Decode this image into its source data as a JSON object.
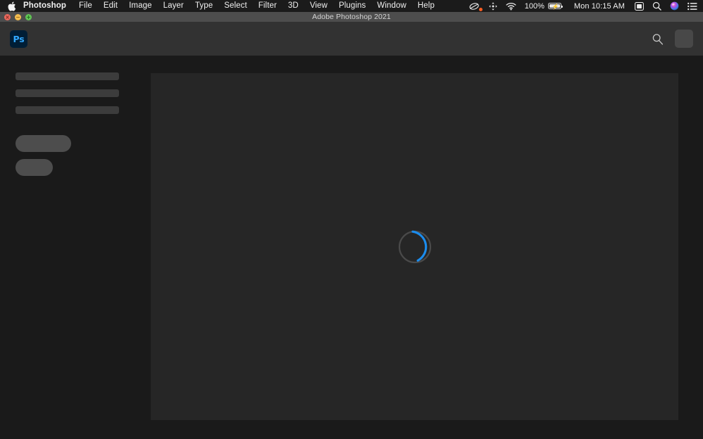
{
  "menubar": {
    "apple_icon": "apple-logo-icon",
    "items": [
      {
        "label": "Photoshop",
        "bold": true
      },
      {
        "label": "File",
        "bold": false
      },
      {
        "label": "Edit",
        "bold": false
      },
      {
        "label": "Image",
        "bold": false
      },
      {
        "label": "Layer",
        "bold": false
      },
      {
        "label": "Type",
        "bold": false
      },
      {
        "label": "Select",
        "bold": false
      },
      {
        "label": "Filter",
        "bold": false
      },
      {
        "label": "3D",
        "bold": false
      },
      {
        "label": "View",
        "bold": false
      },
      {
        "label": "Plugins",
        "bold": false
      },
      {
        "label": "Window",
        "bold": false
      },
      {
        "label": "Help",
        "bold": false
      }
    ],
    "status": {
      "screen_recording_icon": "screen-recording-icon",
      "airdrop_icon": "bluetooth-transfer-icon",
      "wifi_icon": "wifi-icon",
      "battery_percent": "100%",
      "battery_icon": "battery-charging-icon",
      "clock": "Mon 10:15 AM",
      "control_center_icon": "control-center-icon",
      "spotlight_icon": "search-icon",
      "siri_icon": "siri-icon",
      "notification_center_icon": "notification-center-icon"
    }
  },
  "window": {
    "title": "Adobe Photoshop 2021",
    "close_glyph": "×",
    "minimize_glyph": "−",
    "maximize_glyph": "+"
  },
  "app_header": {
    "logo_text": "Ps",
    "logo_bg": "#001e36",
    "logo_fg": "#31a8ff",
    "search_icon": "search-icon",
    "avatar": "user-avatar-placeholder"
  },
  "sidebar": {
    "skeleton_bars": [
      {
        "name": "skeleton-bar-1"
      },
      {
        "name": "skeleton-bar-2"
      },
      {
        "name": "skeleton-bar-3"
      }
    ],
    "skeleton_buttons": [
      {
        "name": "skeleton-button-primary"
      },
      {
        "name": "skeleton-button-secondary"
      }
    ],
    "bar_color": "#3c3c3c",
    "pill_color": "#4d4d4d"
  },
  "main": {
    "panel_bg": "#262626",
    "loading_spinner": {
      "name": "loading-spinner",
      "track_color": "#4a4a4a",
      "arc_color": "#1b8ced",
      "state": "loading"
    }
  },
  "colors": {
    "desktop_bg": "#1a1a1a",
    "menubar_bg": "#1b1b1b",
    "titlebar_bg": "#4d4d4d",
    "header_bg": "#323232",
    "accent": "#31a8ff"
  }
}
